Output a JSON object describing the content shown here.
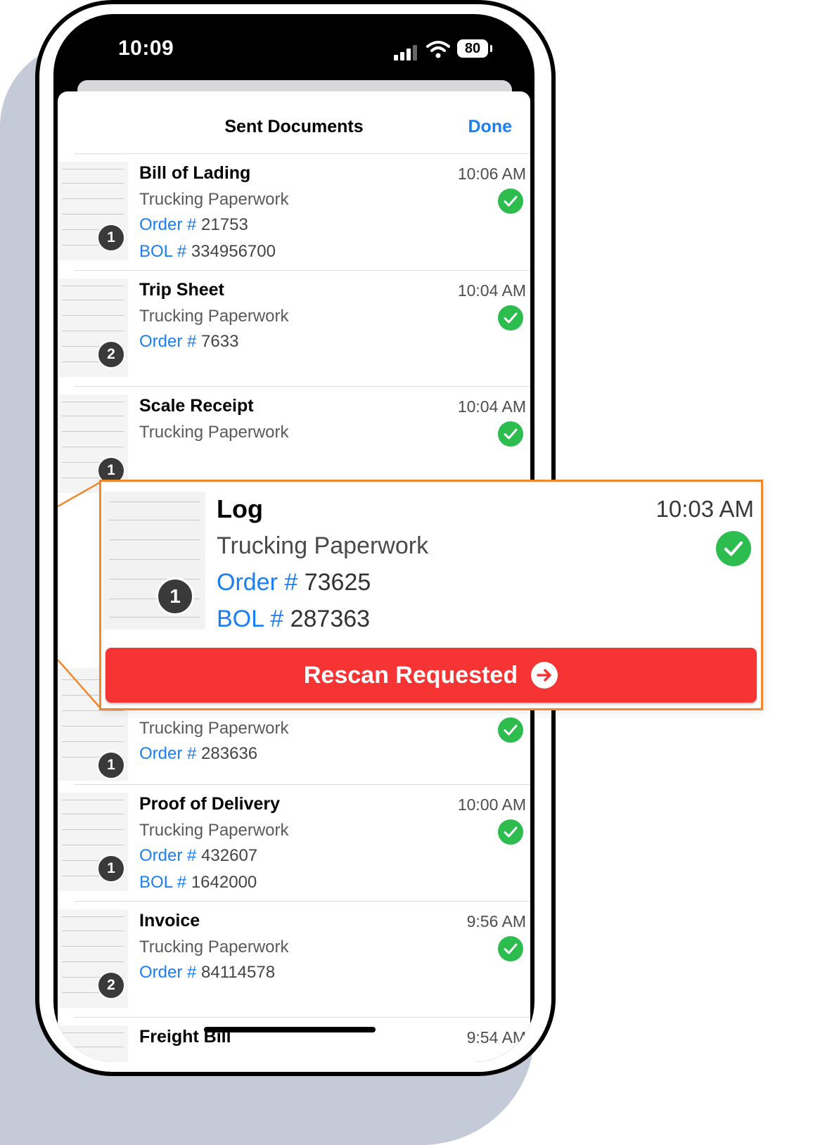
{
  "status_bar": {
    "time": "10:09",
    "battery": "80"
  },
  "sheet": {
    "title": "Sent Documents",
    "done_label": "Done"
  },
  "labels": {
    "order": "Order #",
    "bol": "BOL #"
  },
  "documents": [
    {
      "title": "Bill of Lading",
      "subtitle": "Trucking Paperwork",
      "time": "10:06 AM",
      "order": "21753",
      "bol": "334956700",
      "pages": "1"
    },
    {
      "title": "Trip Sheet",
      "subtitle": "Trucking Paperwork",
      "time": "10:04 AM",
      "order": "7633",
      "pages": "2"
    },
    {
      "title": "Scale Receipt",
      "subtitle": "Trucking Paperwork",
      "time": "10:04 AM",
      "pages": "1"
    },
    {
      "title": "",
      "subtitle": "Trucking Paperwork",
      "time": "",
      "order": "283636",
      "pages": "1"
    },
    {
      "title": "Proof of Delivery",
      "subtitle": "Trucking Paperwork",
      "time": "10:00 AM",
      "order": "432607",
      "bol": "1642000",
      "pages": "1"
    },
    {
      "title": "Invoice",
      "subtitle": "Trucking Paperwork",
      "time": "9:56 AM",
      "order": "84114578",
      "pages": "2"
    },
    {
      "title": "Freight Bill",
      "subtitle": "",
      "time": "9:54 AM",
      "pages": ""
    }
  ],
  "callout": {
    "title": "Log",
    "subtitle": "Trucking Paperwork",
    "time": "10:03 AM",
    "order": "73625",
    "bol": "287363",
    "pages": "1",
    "button_label": "Rescan Requested"
  },
  "colors": {
    "accent": "#1a7ef5",
    "success": "#2dbd4e",
    "danger": "#f53433",
    "highlight": "#f0872a"
  },
  "icons": [
    "signal-icon",
    "wifi-icon",
    "battery-icon",
    "checkmark-circle-icon",
    "arrow-right-circle-icon"
  ]
}
